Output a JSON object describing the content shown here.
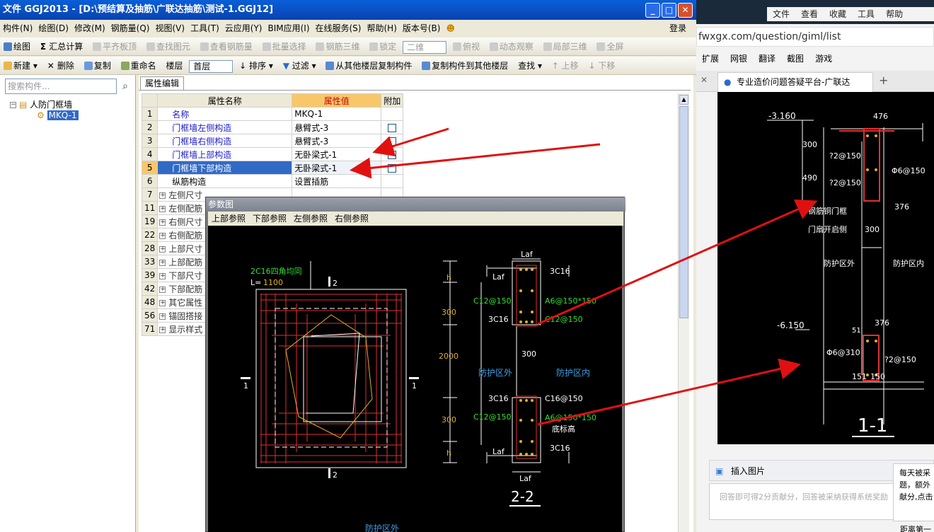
{
  "window": {
    "title": "文件 GGJ2013 - [D:\\预结算及抽筋\\广联达抽筋\\测试-1.GGJ12]",
    "login": "登录"
  },
  "menu": [
    "构件(N)",
    "绘图(D)",
    "修改(M)",
    "钢筋量(Q)",
    "视图(V)",
    "工具(T)",
    "云应用(Y)",
    "BIM应用(I)",
    "在线服务(S)",
    "帮助(H)",
    "版本号(B)"
  ],
  "toolbar1": {
    "items": [
      "绘图",
      "汇总计算",
      "平齐板顶",
      "查找图元",
      "查看钢筋量",
      "批量选择",
      "钢筋三维",
      "锁定"
    ],
    "view_mode": "二维",
    "items2": [
      "俯视",
      "动态观察",
      "局部三维",
      "全屏"
    ]
  },
  "toolbar2": {
    "new": "新建",
    "delete": "删除",
    "copy": "复制",
    "rename": "重命名",
    "floor_label": "楼层",
    "floor_value": "首层",
    "sort": "排序",
    "filter": "过滤",
    "copy_from_floor": "从其他楼层复制构件",
    "copy_to_floor": "复制构件到其他楼层",
    "find": "查找",
    "move_up": "上移",
    "move_down": "下移"
  },
  "left": {
    "search_placeholder": "搜索构件...",
    "tree_root": "人防门框墙",
    "tree_child": "MKQ-1"
  },
  "prop": {
    "tab": "属性编辑",
    "headers": {
      "name": "属性名称",
      "value": "属性值",
      "add": "附加"
    },
    "rows": [
      {
        "n": "1",
        "name": "名称",
        "value": "MKQ-1"
      },
      {
        "n": "2",
        "name": "门框墙左侧构造",
        "value": "悬臂式-3"
      },
      {
        "n": "3",
        "name": "门框墙右侧构造",
        "value": "悬臂式-3"
      },
      {
        "n": "4",
        "name": "门框墙上部构造",
        "value": "无卧梁式-1"
      },
      {
        "n": "5",
        "name": "门框墙下部构造",
        "value": "无卧梁式-1"
      },
      {
        "n": "6",
        "name": "纵筋构造",
        "value": "设置插筋"
      },
      {
        "n": "7",
        "name": "左侧尺寸"
      },
      {
        "n": "11",
        "name": "左侧配筋"
      },
      {
        "n": "19",
        "name": "右侧尺寸"
      },
      {
        "n": "22",
        "name": "右侧配筋"
      },
      {
        "n": "28",
        "name": "上部尺寸"
      },
      {
        "n": "33",
        "name": "上部配筋"
      },
      {
        "n": "39",
        "name": "下部尺寸"
      },
      {
        "n": "42",
        "name": "下部配筋"
      },
      {
        "n": "48",
        "name": "其它属性"
      },
      {
        "n": "56",
        "name": "锚固搭接"
      },
      {
        "n": "71",
        "name": "显示样式"
      }
    ]
  },
  "dialog": {
    "title": "参数图",
    "menu": [
      "上部参照",
      "下部参照",
      "左侧参照",
      "右侧参照"
    ],
    "cad": {
      "bar1": "2C16四角均同",
      "len_label": "L=",
      "len_value": "1100",
      "sec2": "2",
      "sec1": "1",
      "laf": "Laf",
      "h": "h",
      "d300": "300",
      "d2000": "2000",
      "wall": "300",
      "c3c16": "3C16",
      "c12": "C12@150",
      "c16": "C16@150",
      "a6": "A6@150*150",
      "outside": "防护区外",
      "inside": "防护区内",
      "bottom_h": "底标高",
      "section_label": "2-2",
      "bottom_text": "防护区外"
    }
  },
  "browser": {
    "nav": [
      "文件",
      "查看",
      "收藏",
      "工具",
      "帮助"
    ],
    "url": "fwxgx.com/question/giml/list",
    "bm": [
      "扩展",
      "网银",
      "翻译",
      "截图",
      "游戏"
    ],
    "tab_title": "专业造价问题答疑平台-广联达",
    "cad": {
      "elev1": "-3.160",
      "d476": "476",
      "d300": "300",
      "d490": "490",
      "r1": "?2@150",
      "r2": "?2@150",
      "phi": "Φ6@150",
      "n376": "376",
      "steel": "钢筋铜门框",
      "door": "门扇开启侧",
      "w300": "300",
      "outside": "防护区外",
      "inside": "防护区内",
      "elev2": "-6.150",
      "d51": "51",
      "n376b": "376",
      "phi2": "Φ6@310",
      "r3": "?2@150",
      "d151": "151",
      "d150": "150",
      "title": "1-1"
    },
    "insert_image": "插入图片",
    "answer_placeholder": "回答即可得2分贡献分，回答被采纳获得系统奖励",
    "notice": [
      "每天被采",
      "题，额外",
      "献分,点击"
    ],
    "bottom": "距离第一"
  }
}
